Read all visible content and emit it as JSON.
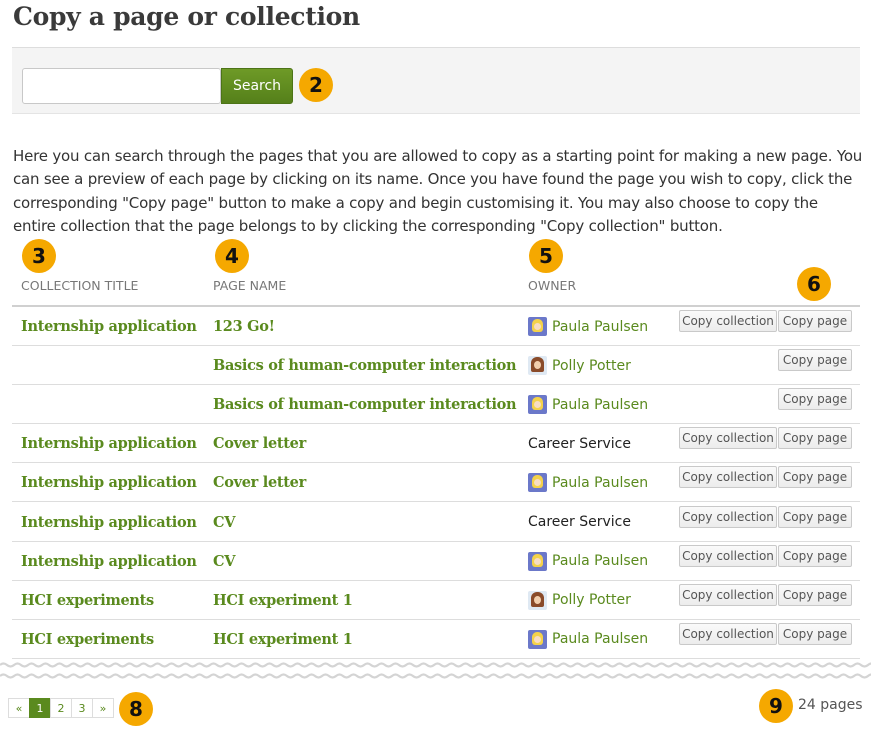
{
  "title": "Copy a page or collection",
  "search": {
    "value": "",
    "placeholder": "",
    "button_label": "Search"
  },
  "description": "Here you can search through the pages that you are allowed to copy as a starting point for making a new page. You can see a preview of each page by clicking on its name. Once you have found the page you wish to copy, click the corresponding \"Copy page\" button to make a copy and begin customising it. You may also choose to copy the entire collection that the page belongs to by clicking the corresponding \"Copy collection\" button.",
  "columns": {
    "collection": "Collection title",
    "page": "Page name",
    "owner": "Owner"
  },
  "buttons": {
    "copy_collection": "Copy collection",
    "copy_page": "Copy page"
  },
  "rows": [
    {
      "collection": "Internship application",
      "page": "123 Go!",
      "owner": "Paula Paulsen",
      "owner_link": true,
      "avatar": "paula",
      "copy_collection": true
    },
    {
      "collection": "",
      "page": "Basics of human-computer interaction",
      "owner": "Polly Potter",
      "owner_link": true,
      "avatar": "polly",
      "copy_collection": false
    },
    {
      "collection": "",
      "page": "Basics of human-computer interaction",
      "owner": "Paula Paulsen",
      "owner_link": true,
      "avatar": "paula",
      "copy_collection": false
    },
    {
      "collection": "Internship application",
      "page": "Cover letter",
      "owner": "Career Service",
      "owner_link": false,
      "avatar": "",
      "copy_collection": true
    },
    {
      "collection": "Internship application",
      "page": "Cover letter",
      "owner": "Paula Paulsen",
      "owner_link": true,
      "avatar": "paula",
      "copy_collection": true
    },
    {
      "collection": "Internship application",
      "page": "CV",
      "owner": "Career Service",
      "owner_link": false,
      "avatar": "",
      "copy_collection": true
    },
    {
      "collection": "Internship application",
      "page": "CV",
      "owner": "Paula Paulsen",
      "owner_link": true,
      "avatar": "paula",
      "copy_collection": true
    },
    {
      "collection": "HCI experiments",
      "page": "HCI experiment 1",
      "owner": "Polly Potter",
      "owner_link": true,
      "avatar": "polly",
      "copy_collection": true
    },
    {
      "collection": "HCI experiments",
      "page": "HCI experiment 1",
      "owner": "Paula Paulsen",
      "owner_link": true,
      "avatar": "paula",
      "copy_collection": true
    }
  ],
  "pagination": {
    "prev": "«",
    "pages": [
      "1",
      "2",
      "3"
    ],
    "current": "1",
    "next": "»"
  },
  "count": "24 pages",
  "callouts": [
    "2",
    "3",
    "4",
    "5",
    "6",
    "8",
    "9"
  ],
  "colors": {
    "link": "#5a8a1e",
    "search_button": "#6e9a27",
    "callout": "#f5a800"
  }
}
